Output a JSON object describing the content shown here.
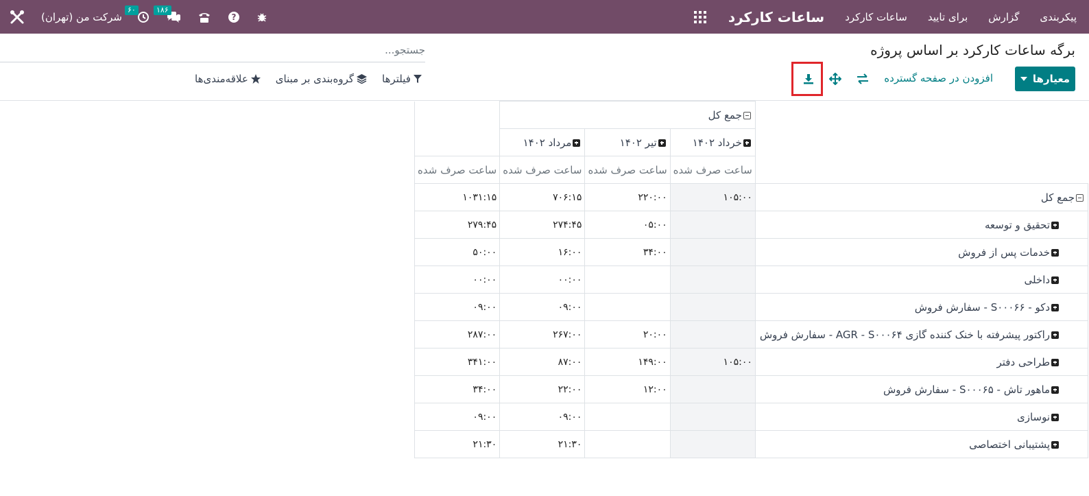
{
  "navbar": {
    "app_name": "ساعات کارکرد",
    "menu": [
      "ساعات کارکرد",
      "برای تایید",
      "گزارش",
      "پیکربندی"
    ],
    "company": "شرکت من (تهران)",
    "activity_count": "۶۰",
    "messages_count": "۱۸۶",
    "icons": [
      "apps-icon",
      "clock-icon",
      "chat-icon",
      "phone-icon",
      "help-icon",
      "bug-icon",
      "tools-icon"
    ],
    "bg_color": "#714b67"
  },
  "control_panel": {
    "title": "برگه ساعات کارکرد بر اساس پروژه",
    "search_placeholder": "جستجو...",
    "measures_label": "معیارها",
    "insert_spreadsheet_label": "افزودن در صفحه گسترده",
    "filters_label": "فیلترها",
    "groupby_label": "گروه‌بندی بر مبنای",
    "favorites_label": "علاقه‌مندی‌ها",
    "accent_color": "#017e84",
    "highlight_color": "#e0262b"
  },
  "pivot": {
    "col_total_label": "جمع کل",
    "months": [
      "خرداد ۱۴۰۲",
      "تیر ۱۴۰۲",
      "مرداد ۱۴۰۲"
    ],
    "measure_label": "ساعت صرف شده",
    "rows": [
      {
        "label": "جمع کل",
        "values": [
          "۱۰۵:۰۰",
          "۲۲۰:۰۰",
          "۷۰۶:۱۵",
          "۱۰۳۱:۱۵"
        ]
      },
      {
        "label": "تحقیق و توسعه",
        "values": [
          "",
          "۰۵:۰۰",
          "۲۷۴:۴۵",
          "۲۷۹:۴۵"
        ]
      },
      {
        "label": "خدمات پس از فروش",
        "values": [
          "",
          "۳۴:۰۰",
          "۱۶:۰۰",
          "۵۰:۰۰"
        ]
      },
      {
        "label": "داخلی",
        "values": [
          "",
          "",
          "۰۰:۰۰",
          "۰۰:۰۰"
        ]
      },
      {
        "label": "دکو - S۰۰۰۶۶ - سفارش فروش",
        "values": [
          "",
          "",
          "۰۹:۰۰",
          "۰۹:۰۰"
        ]
      },
      {
        "label": "راکتور پیشرفته با خنک کننده گازی AGR - S۰۰۰۶۴ - سفارش فروش",
        "values": [
          "",
          "۲۰:۰۰",
          "۲۶۷:۰۰",
          "۲۸۷:۰۰"
        ]
      },
      {
        "label": "طراحی دفتر",
        "values": [
          "۱۰۵:۰۰",
          "۱۴۹:۰۰",
          "۸۷:۰۰",
          "۳۴۱:۰۰"
        ]
      },
      {
        "label": "ماهور تاش - S۰۰۰۶۵ - سفارش فروش",
        "values": [
          "",
          "۱۲:۰۰",
          "۲۲:۰۰",
          "۳۴:۰۰"
        ]
      },
      {
        "label": "نوسازی",
        "values": [
          "",
          "",
          "۰۹:۰۰",
          "۰۹:۰۰"
        ]
      },
      {
        "label": "پشتیبانی اختصاصی",
        "values": [
          "",
          "",
          "۲۱:۳۰",
          "۲۱:۳۰"
        ]
      }
    ]
  }
}
